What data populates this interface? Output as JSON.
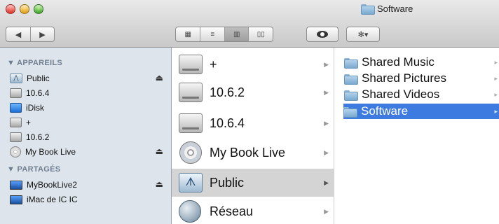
{
  "window": {
    "title": "Software",
    "title_icon": "folder-icon"
  },
  "toolbar": {
    "back_icon": "◀",
    "forward_icon": "▶",
    "view_icon_grid": "▦",
    "view_icon_list": "≡",
    "view_icon_columns": "▥",
    "view_icon_coverflow": "▯▯",
    "eye_icon": "eye-icon",
    "gear_icon": "✻▾"
  },
  "sidebar": {
    "devices_header": "▼ APPAREILS",
    "devices": [
      {
        "label": "Public",
        "icon": "network-disk-icon",
        "eject": true
      },
      {
        "label": "10.6.4",
        "icon": "disk-icon",
        "eject": false
      },
      {
        "label": "iDisk",
        "icon": "idisk-icon",
        "eject": false
      },
      {
        "label": "+",
        "icon": "disk-icon",
        "eject": false
      },
      {
        "label": "10.6.2",
        "icon": "disk-icon",
        "eject": false
      },
      {
        "label": "My Book Live",
        "icon": "cd-icon",
        "eject": true
      }
    ],
    "shared_header": "▼ PARTAGÉS",
    "shared": [
      {
        "label": "MyBookLive2",
        "icon": "monitor-icon",
        "eject": true
      },
      {
        "label": "iMac de IC IC",
        "icon": "monitor-icon",
        "eject": false
      }
    ],
    "eject_symbol": "⏏"
  },
  "middle_column": {
    "items": [
      {
        "label": "+",
        "icon": "disk-icon",
        "selected": false
      },
      {
        "label": "10.6.2",
        "icon": "disk-icon",
        "selected": false
      },
      {
        "label": "10.6.4",
        "icon": "disk-icon",
        "selected": false
      },
      {
        "label": "My Book Live",
        "icon": "cd-icon",
        "selected": false
      },
      {
        "label": "Public",
        "icon": "network-share-icon",
        "selected": true
      },
      {
        "label": "Réseau",
        "icon": "network-globe-icon",
        "selected": false
      }
    ],
    "arrow_symbol": "▶"
  },
  "right_column": {
    "items": [
      {
        "label": "Shared Music",
        "icon": "folder-icon",
        "selected": false
      },
      {
        "label": "Shared Pictures",
        "icon": "folder-icon",
        "selected": false
      },
      {
        "label": "Shared Videos",
        "icon": "folder-icon",
        "selected": false
      },
      {
        "label": "Software",
        "icon": "folder-icon",
        "selected": true
      }
    ],
    "tick_symbol": "▸"
  },
  "colors": {
    "selection_blue": "#3d7be0",
    "sidebar_bg": "#dde4ec",
    "middle_selected": "#d4d4d4"
  }
}
